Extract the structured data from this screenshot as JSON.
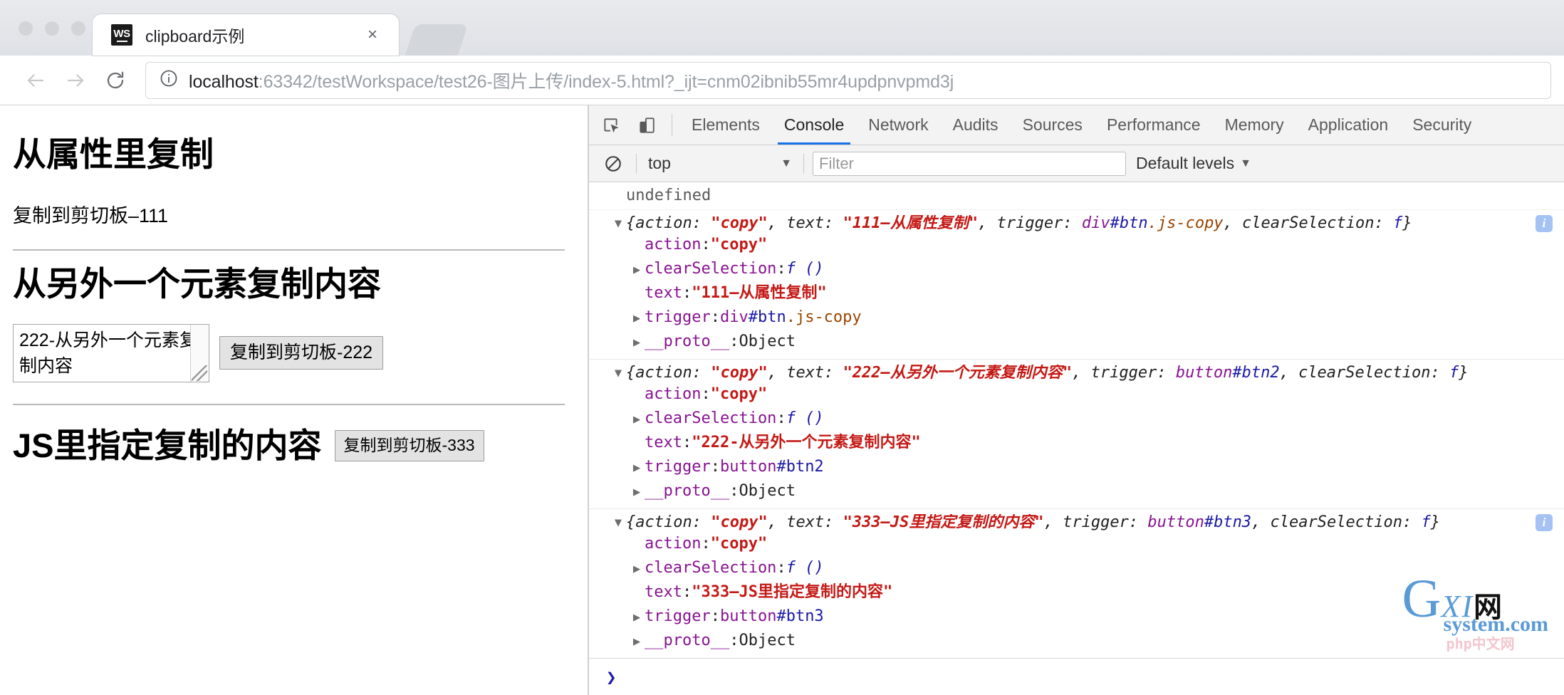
{
  "browser": {
    "tab": {
      "favicon_label": "WS",
      "title": "clipboard示例",
      "close_label": "×"
    },
    "nav": {
      "back_icon": "arrow-left-icon",
      "forward_icon": "arrow-right-icon",
      "reload_icon": "reload-icon",
      "info_icon": "page-info-icon"
    },
    "omnibox": {
      "host": "localhost",
      "path": ":63342/testWorkspace/test26-图片上传/index-5.html?_ijt=cnm02ibnib55mr4updpnvpmd3j",
      "full_url": "localhost:63342/testWorkspace/test26-图片上传/index-5.html?_ijt=cnm02ibnib55mr4updpnvpmd3j"
    }
  },
  "page": {
    "section1": {
      "heading": "从属性里复制",
      "copy_text": "复制到剪切板–111"
    },
    "section2": {
      "heading": "从另外一个元素复制内容",
      "textarea_value": "222-从另外一个元素复制内容",
      "button_label": "复制到剪切板-222"
    },
    "section3": {
      "heading": "JS里指定复制的内容",
      "button_label": "复制到剪切板-333"
    }
  },
  "devtools": {
    "icons": {
      "inspect": "inspect-element-icon",
      "device": "device-toolbar-icon",
      "clear": "clear-console-icon"
    },
    "tabs": [
      {
        "label": "Elements",
        "active": false
      },
      {
        "label": "Console",
        "active": true
      },
      {
        "label": "Network",
        "active": false
      },
      {
        "label": "Audits",
        "active": false
      },
      {
        "label": "Sources",
        "active": false
      },
      {
        "label": "Performance",
        "active": false
      },
      {
        "label": "Memory",
        "active": false
      },
      {
        "label": "Application",
        "active": false
      },
      {
        "label": "Security",
        "active": false
      }
    ],
    "filterbar": {
      "context": "top",
      "context_caret": "▼",
      "filter_placeholder": "Filter",
      "levels": "Default levels",
      "levels_caret": "▼"
    },
    "console": {
      "first_message": "undefined",
      "entries": [
        {
          "collapse_arrow": "▼",
          "summary_prefix": "{action: ",
          "summary_action": "\"copy\"",
          "summary_mid": ", text: ",
          "summary_text": "\"111–从属性复制\"",
          "summary_trigger_label": ", trigger: ",
          "trigger_tag": "div",
          "trigger_id": "#btn",
          "trigger_class": ".js-copy",
          "summary_suffix": ", clearSelection: ",
          "summary_fn": "f",
          "summary_close": "}",
          "has_info_badge": true,
          "info_badge": "i",
          "props": [
            {
              "arrow": "",
              "key": "action",
              "sep": ": ",
              "value": "\"copy\"",
              "kind": "string"
            },
            {
              "arrow": "▶",
              "key": "clearSelection",
              "sep": ": ",
              "value": "f ()",
              "kind": "function"
            },
            {
              "arrow": "",
              "key": "text",
              "sep": ": ",
              "value": "\"111–从属性复制\"",
              "kind": "string"
            },
            {
              "arrow": "▶",
              "key": "trigger",
              "sep": ": ",
              "value": "div#btn.js-copy",
              "kind": "node",
              "tag": "div",
              "id": "#btn",
              "cls": ".js-copy"
            },
            {
              "arrow": "▶",
              "key": "__proto__",
              "sep": ": ",
              "value": "Object",
              "kind": "object"
            }
          ]
        },
        {
          "collapse_arrow": "▼",
          "summary_prefix": "{action: ",
          "summary_action": "\"copy\"",
          "summary_mid": ", text: ",
          "summary_text": "\"222–从另外一个元素复制内容\"",
          "summary_trigger_label": ", trigger: ",
          "trigger_tag": "button",
          "trigger_id": "#btn2",
          "trigger_class": "",
          "summary_suffix": ", clearSelection: ",
          "summary_fn": "f",
          "summary_close": "}",
          "has_info_badge": false,
          "info_badge": "",
          "props": [
            {
              "arrow": "",
              "key": "action",
              "sep": ": ",
              "value": "\"copy\"",
              "kind": "string"
            },
            {
              "arrow": "▶",
              "key": "clearSelection",
              "sep": ": ",
              "value": "f ()",
              "kind": "function"
            },
            {
              "arrow": "",
              "key": "text",
              "sep": ": ",
              "value": "\"222-从另外一个元素复制内容\"",
              "kind": "string"
            },
            {
              "arrow": "▶",
              "key": "trigger",
              "sep": ": ",
              "value": "button#btn2",
              "kind": "node",
              "tag": "button",
              "id": "#btn2",
              "cls": ""
            },
            {
              "arrow": "▶",
              "key": "__proto__",
              "sep": ": ",
              "value": "Object",
              "kind": "object"
            }
          ]
        },
        {
          "collapse_arrow": "▼",
          "summary_prefix": "{action: ",
          "summary_action": "\"copy\"",
          "summary_mid": ", text: ",
          "summary_text": "\"333–JS里指定复制的内容\"",
          "summary_trigger_label": ", trigger: ",
          "trigger_tag": "button",
          "trigger_id": "#btn3",
          "trigger_class": "",
          "summary_suffix": ", clearSelection: ",
          "summary_fn": "f",
          "summary_close": "}",
          "has_info_badge": true,
          "info_badge": "i",
          "props": [
            {
              "arrow": "",
              "key": "action",
              "sep": ": ",
              "value": "\"copy\"",
              "kind": "string"
            },
            {
              "arrow": "▶",
              "key": "clearSelection",
              "sep": ": ",
              "value": "f ()",
              "kind": "function"
            },
            {
              "arrow": "",
              "key": "text",
              "sep": ": ",
              "value": "\"333–JS里指定复制的内容\"",
              "kind": "string"
            },
            {
              "arrow": "▶",
              "key": "trigger",
              "sep": ": ",
              "value": "button#btn3",
              "kind": "node",
              "tag": "button",
              "id": "#btn3",
              "cls": ""
            },
            {
              "arrow": "▶",
              "key": "__proto__",
              "sep": ": ",
              "value": "Object",
              "kind": "object"
            }
          ]
        }
      ],
      "prompt": "❯"
    }
  },
  "watermark": {
    "g": "G",
    "xi": "XI",
    "cn": "网",
    "domain": "system.com",
    "sub": "php中文网"
  },
  "colors": {
    "accent": "#1a73e8",
    "string": "#c41a16",
    "property": "#881391",
    "id": "#1a1aa6",
    "class": "#994500",
    "watermark": "#5b9bd5"
  }
}
